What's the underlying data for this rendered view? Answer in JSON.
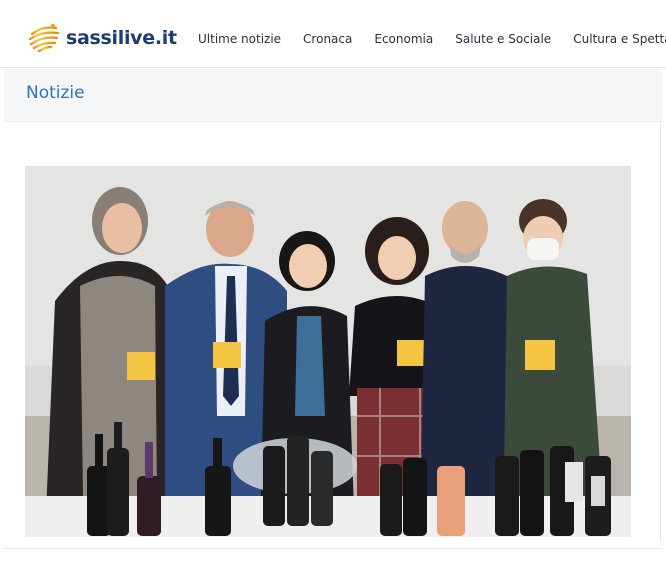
{
  "site": {
    "logo_text": "sassilive.it",
    "logo_icon": "sun-swirl-logo-icon"
  },
  "nav": {
    "items": [
      {
        "label": "Ultime notizie"
      },
      {
        "label": "Cronaca"
      },
      {
        "label": "Economia"
      },
      {
        "label": "Salute e Sociale"
      },
      {
        "label": "Cultura e Spettacoli"
      }
    ]
  },
  "section": {
    "title": "Notizie"
  },
  "colors": {
    "brand_navy": "#1d3d6e",
    "brand_orange": "#f2a31b",
    "section_title": "#2f74b5",
    "section_bg": "#f5f6f8"
  }
}
